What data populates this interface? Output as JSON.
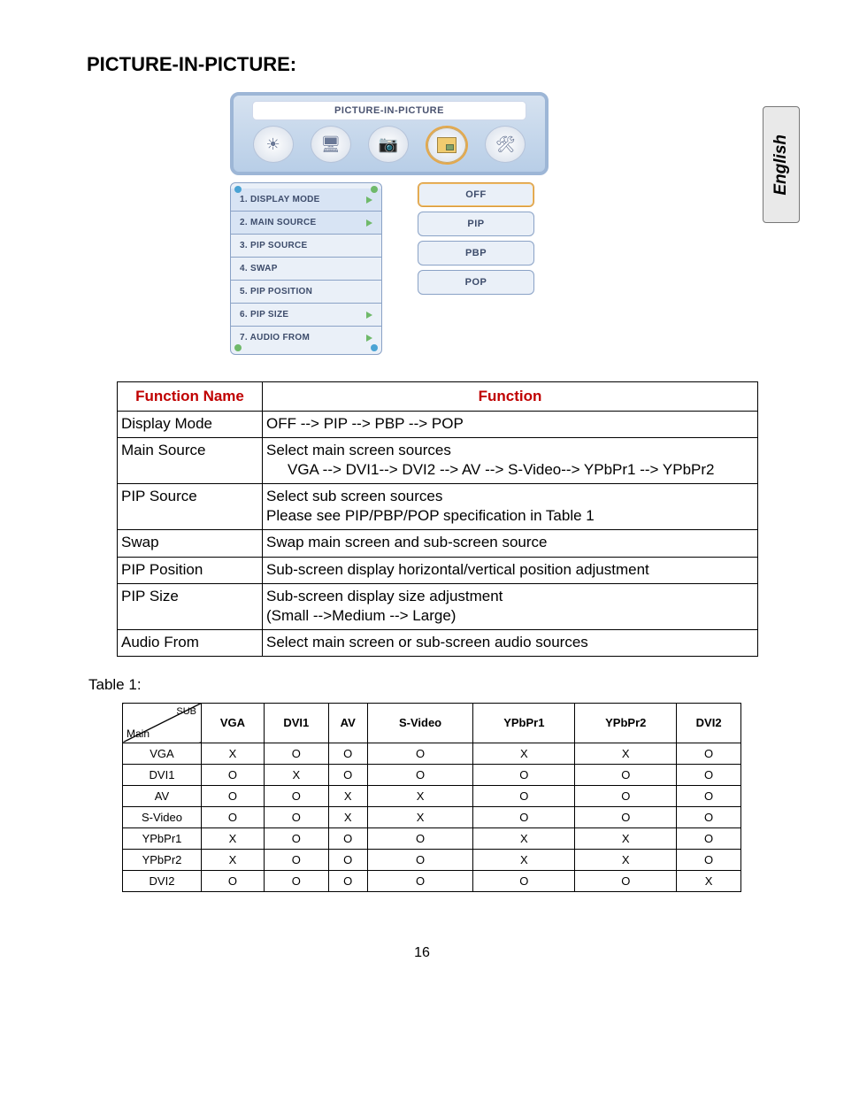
{
  "heading": "PICTURE-IN-PICTURE:",
  "side_tab": "English",
  "osd": {
    "title": "PICTURE-IN-PICTURE",
    "menu": [
      "1. DISPLAY MODE",
      "2. MAIN SOURCE",
      "3. PIP SOURCE",
      "4. SWAP",
      "5. PIP POSITION",
      "6. PIP SIZE",
      "7. AUDIO FROM"
    ],
    "submenu": [
      "OFF",
      "PIP",
      "PBP",
      "POP"
    ]
  },
  "func": {
    "header_name": "Function Name",
    "header_func": "Function",
    "rows": [
      {
        "name": "Display Mode",
        "desc": "OFF --> PIP --> PBP --> POP"
      },
      {
        "name": "Main Source",
        "desc": "Select main screen sources",
        "desc2": "VGA --> DVI1--> DVI2 --> AV --> S-Video--> YPbPr1 --> YPbPr2"
      },
      {
        "name": "PIP Source",
        "desc": "Select sub screen sources",
        "desc2b": "Please see PIP/PBP/POP specification in Table 1"
      },
      {
        "name": "Swap",
        "desc": "Swap main screen and sub-screen source"
      },
      {
        "name": "PIP Position",
        "desc": "Sub-screen display horizontal/vertical position adjustment"
      },
      {
        "name": "PIP Size",
        "desc": "Sub-screen display size adjustment",
        "desc2b": "(Small -->Medium --> Large)"
      },
      {
        "name": "Audio From",
        "desc": "Select main screen or sub-screen audio sources"
      }
    ]
  },
  "table1_label": "Table 1:",
  "matrix": {
    "sub_label": "SUB",
    "main_label": "Main",
    "cols": [
      "VGA",
      "DVI1",
      "AV",
      "S-Video",
      "YPbPr1",
      "YPbPr2",
      "DVI2"
    ],
    "rows": [
      {
        "h": "VGA",
        "c": [
          "X",
          "O",
          "O",
          "O",
          "X",
          "X",
          "O"
        ]
      },
      {
        "h": "DVI1",
        "c": [
          "O",
          "X",
          "O",
          "O",
          "O",
          "O",
          "O"
        ]
      },
      {
        "h": "AV",
        "c": [
          "O",
          "O",
          "X",
          "X",
          "O",
          "O",
          "O"
        ]
      },
      {
        "h": "S-Video",
        "c": [
          "O",
          "O",
          "X",
          "X",
          "O",
          "O",
          "O"
        ]
      },
      {
        "h": "YPbPr1",
        "c": [
          "X",
          "O",
          "O",
          "O",
          "X",
          "X",
          "O"
        ]
      },
      {
        "h": "YPbPr2",
        "c": [
          "X",
          "O",
          "O",
          "O",
          "X",
          "X",
          "O"
        ]
      },
      {
        "h": "DVI2",
        "c": [
          "O",
          "O",
          "O",
          "O",
          "O",
          "O",
          "X"
        ]
      }
    ]
  },
  "page_number": "16"
}
